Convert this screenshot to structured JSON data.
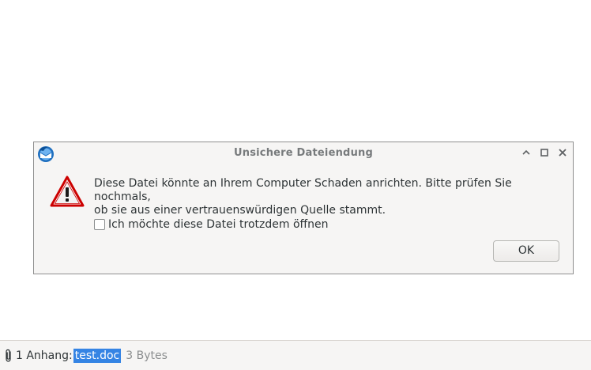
{
  "dialog": {
    "title": "Unsichere Dateiendung",
    "message": "Diese Datei könnte an Ihrem Computer Schaden anrichten. Bitte prüfen Sie nochmals,\nob sie aus einer vertrauenswürdigen Quelle stammt.",
    "checkbox_label": "Ich möchte diese Datei trotzdem öffnen",
    "checkbox_checked": false,
    "ok_label": "OK"
  },
  "attachments": {
    "count_label": "1 Anhang:",
    "file_name": "test.doc",
    "file_size": "3 Bytes"
  },
  "icons": {
    "app": "thunderbird-icon",
    "warning": "warning-triangle-icon",
    "minimize": "chevron-up-icon",
    "maximize": "maximize-icon",
    "close": "close-icon",
    "attachment": "paperclip-icon"
  },
  "colors": {
    "warning_red": "#cc0000",
    "selection": "#3584e4"
  }
}
